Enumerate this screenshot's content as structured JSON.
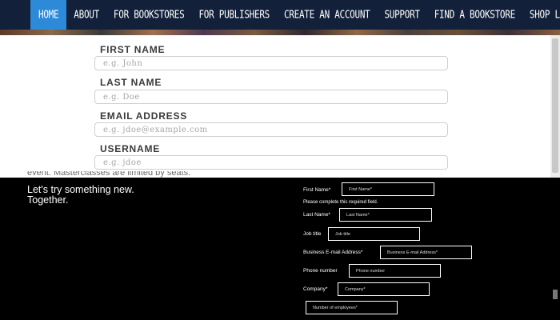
{
  "nav": {
    "items": [
      {
        "label": "HOME",
        "active": true
      },
      {
        "label": "ABOUT",
        "active": false
      },
      {
        "label": "FOR BOOKSTORES",
        "active": false
      },
      {
        "label": "FOR PUBLISHERS",
        "active": false
      },
      {
        "label": "CREATE AN ACCOUNT",
        "active": false
      },
      {
        "label": "SUPPORT",
        "active": false
      },
      {
        "label": "FIND A BOOKSTORE",
        "active": false
      },
      {
        "label": "SHOP LOCAL",
        "active": false
      }
    ],
    "active_color": "#2c8ad9",
    "background": "#12203a"
  },
  "signup": {
    "first_name": {
      "label": "FIRST NAME",
      "placeholder": "e.g. John",
      "value": ""
    },
    "last_name": {
      "label": "LAST NAME",
      "placeholder": "e.g. Doe",
      "value": ""
    },
    "email": {
      "label": "EMAIL ADDRESS",
      "placeholder": "e.g. jdoe@example.com",
      "value": ""
    },
    "username": {
      "label": "USERNAME",
      "placeholder": "e.g. jdoe",
      "value": ""
    }
  },
  "promo": {
    "cut_text": "event. Masterclasses are limited by seats.",
    "headline_line1": "Let's try something new.",
    "headline_line2": "Together."
  },
  "lead_form": {
    "first_name": {
      "label": "First Name*",
      "placeholder": "First Name*"
    },
    "error": "Please complete this required field.",
    "last_name": {
      "label": "Last Name*",
      "placeholder": "Last Name*"
    },
    "job_title": {
      "label": "Job title",
      "placeholder": "Job title"
    },
    "email": {
      "label": "Business E-mail Address*",
      "placeholder": "Business E-mail Address*"
    },
    "phone": {
      "label": "Phone number",
      "placeholder": "Phone number"
    },
    "company": {
      "label": "Company*",
      "placeholder": "Company*"
    },
    "employees": {
      "placeholder": "Number of employees*"
    }
  }
}
